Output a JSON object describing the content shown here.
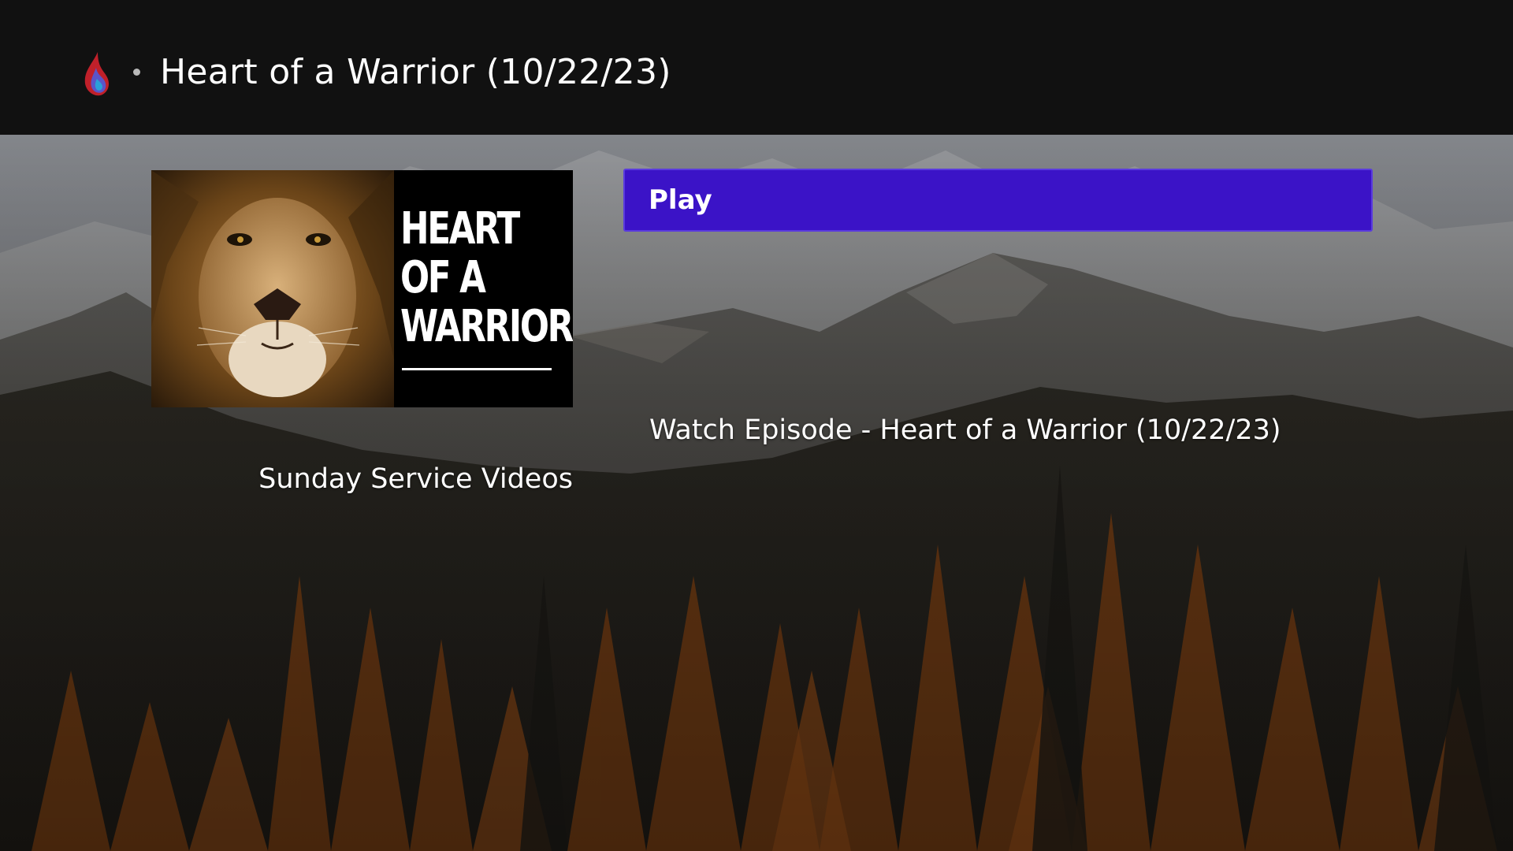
{
  "header": {
    "logo_icon": "flame-drop-icon",
    "separator_icon": "bullet-dot-icon",
    "title": "Heart of a Warrior (10/22/23)"
  },
  "poster": {
    "line1": "HEART",
    "line2": "OF A",
    "line3": "WARRIOR",
    "art_icon": "lion-face-image"
  },
  "play_button": {
    "label": "Play"
  },
  "episode": {
    "description": "Watch Episode - Heart of a Warrior (10/22/23)"
  },
  "category": {
    "label": "Sunday Service Videos"
  },
  "colors": {
    "header_bg": "#111111",
    "accent": "#3b13c7",
    "text": "#ffffff"
  }
}
